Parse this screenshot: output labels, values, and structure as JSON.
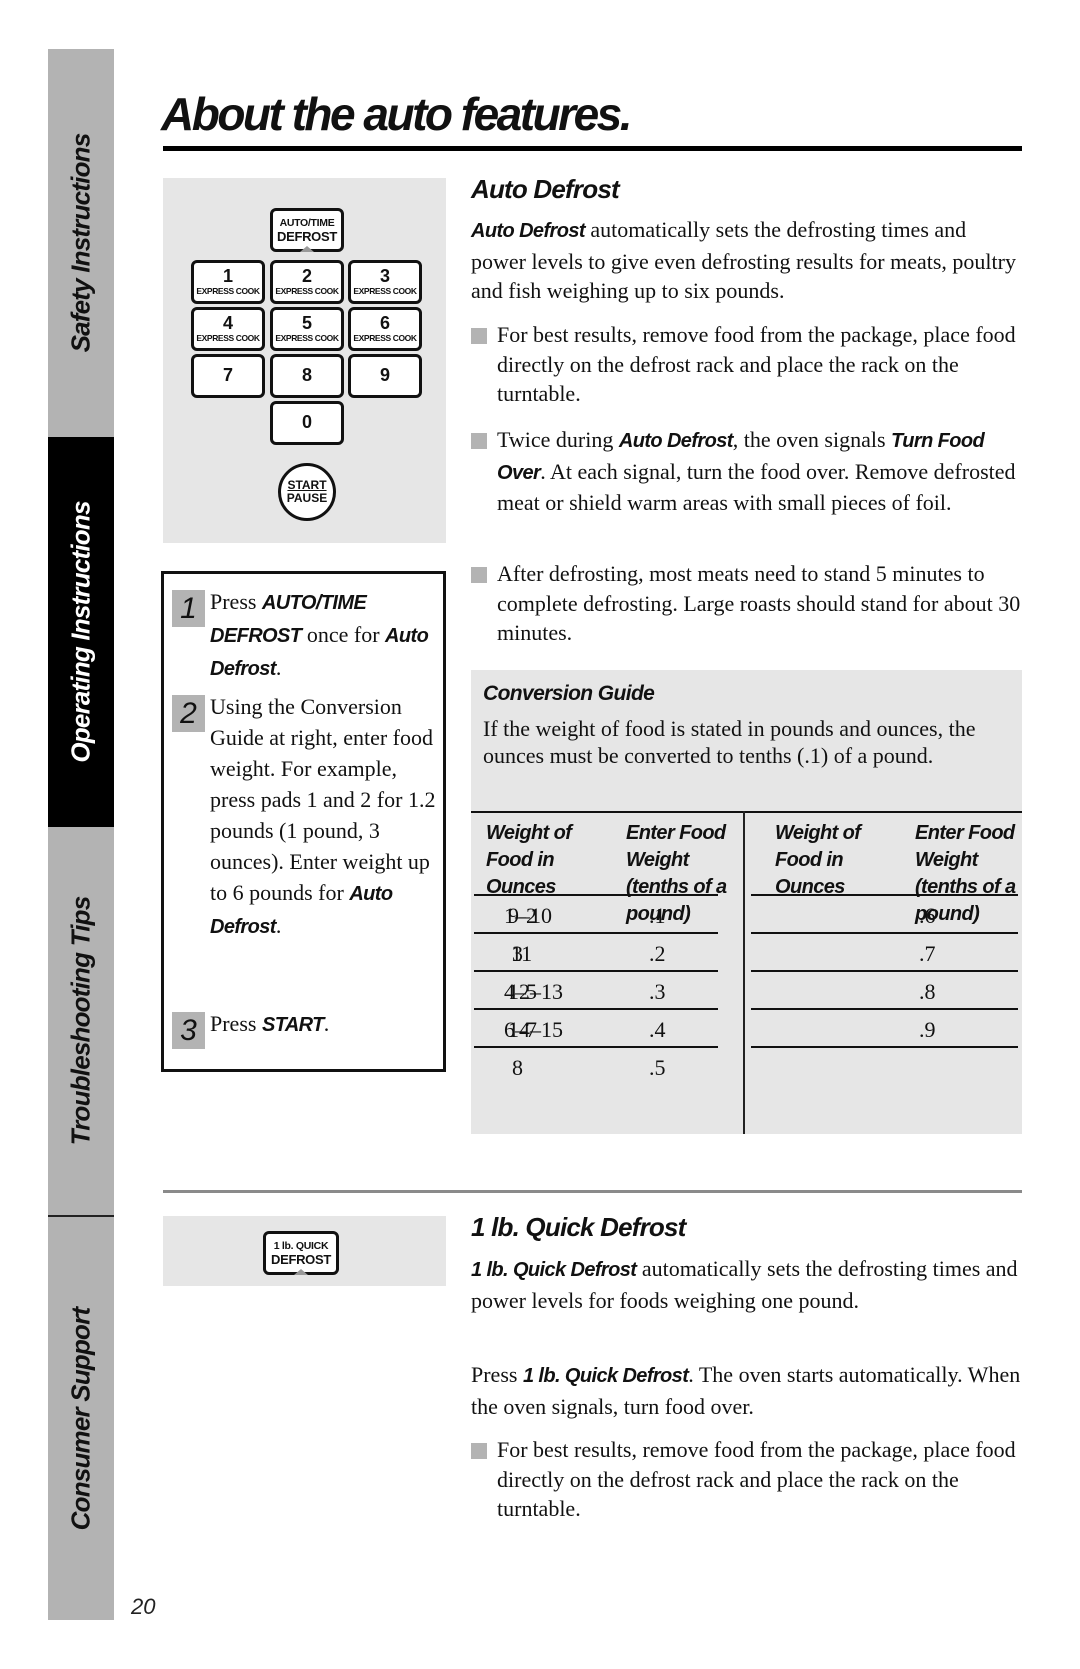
{
  "sidebar": {
    "tabs": [
      {
        "label": "Safety Instructions",
        "active": false
      },
      {
        "label": "Operating Instructions",
        "active": true
      },
      {
        "label": "Troubleshooting Tips",
        "active": false
      },
      {
        "label": "Consumer Support",
        "active": false
      }
    ]
  },
  "page": {
    "title": "About the auto features.",
    "number": "20"
  },
  "keypad": {
    "auto_time_defrost": [
      "AUTO/TIME",
      "DEFROST"
    ],
    "keys": [
      {
        "num": "1",
        "sub": "EXPRESS COOK"
      },
      {
        "num": "2",
        "sub": "EXPRESS COOK"
      },
      {
        "num": "3",
        "sub": "EXPRESS COOK"
      },
      {
        "num": "4",
        "sub": "EXPRESS COOK"
      },
      {
        "num": "5",
        "sub": "EXPRESS COOK"
      },
      {
        "num": "6",
        "sub": "EXPRESS COOK"
      },
      {
        "num": "7",
        "sub": ""
      },
      {
        "num": "8",
        "sub": ""
      },
      {
        "num": "9",
        "sub": ""
      },
      {
        "num": "0",
        "sub": ""
      }
    ],
    "start": "START",
    "pause": "PAUSE"
  },
  "steps": [
    {
      "num": "1",
      "parts": [
        {
          "t": "Press ",
          "b": false
        },
        {
          "t": "AUTO/TIME DEFROST",
          "b": true
        },
        {
          "t": " once for ",
          "b": false
        },
        {
          "t": "Auto Defrost",
          "b": true
        },
        {
          "t": ".",
          "b": false
        }
      ]
    },
    {
      "num": "2",
      "parts": [
        {
          "t": "Using the Conversion Guide at right, enter food weight. For example, press pads 1 and 2 for 1.2 pounds (1 pound, 3 ounces). Enter weight up to 6 pounds for ",
          "b": false
        },
        {
          "t": "Auto Defrost",
          "b": true
        },
        {
          "t": ".",
          "b": false
        }
      ]
    },
    {
      "num": "3",
      "parts": [
        {
          "t": "Press ",
          "b": false
        },
        {
          "t": "START",
          "b": true
        },
        {
          "t": ".",
          "b": false
        }
      ]
    }
  ],
  "auto_defrost": {
    "heading": "Auto Defrost",
    "intro_bold": "Auto Defrost",
    "intro_rest": " automatically sets the defrosting times and power levels to give even defrosting results for meats, poultry and fish weighing up to six pounds.",
    "bullets": [
      [
        {
          "t": "For best results, remove food from the package, place food directly on the defrost rack and place the rack on the turntable.",
          "b": false
        }
      ],
      [
        {
          "t": "Twice during ",
          "b": false
        },
        {
          "t": "Auto Defrost",
          "b": true
        },
        {
          "t": ", the oven signals ",
          "b": false
        },
        {
          "t": "Turn Food Over",
          "b": true
        },
        {
          "t": ". At each signal, turn the food over. Remove defrosted meat or shield warm areas with small pieces of foil.",
          "b": false
        }
      ],
      [
        {
          "t": "After defrosting, most meats need to stand 5 minutes to complete defrosting. Large roasts should stand for about 30 minutes.",
          "b": false
        }
      ]
    ]
  },
  "conversion_guide": {
    "heading": "Conversion Guide",
    "text": "If the weight of food is stated in pounds and ounces, the ounces must be converted to tenths (.1) of a pound.",
    "headers": [
      "Weight of Food in Ounces",
      "Enter Food Weight (tenths of a pound)"
    ],
    "left_rows": [
      [
        "1–2",
        ".1"
      ],
      [
        "3",
        ".2"
      ],
      [
        "4–5",
        ".3"
      ],
      [
        "6–7",
        ".4"
      ],
      [
        "8",
        ".5"
      ]
    ],
    "right_rows": [
      [
        "9–10",
        ".6"
      ],
      [
        "11",
        ".7"
      ],
      [
        "12–13",
        ".8"
      ],
      [
        "14–15",
        ".9"
      ]
    ]
  },
  "quick_defrost": {
    "button": [
      "1 lb. QUICK",
      "DEFROST"
    ],
    "heading": "1 lb. Quick Defrost",
    "intro_bold": "1 lb. Quick Defrost",
    "intro_rest": " automatically sets the defrosting times and power levels for foods weighing one pound.",
    "press_pre": "Press ",
    "press_bold": "1 lb. Quick Defrost",
    "press_rest": ". The oven starts automatically. When the oven signals, turn food over.",
    "bullet": "For best results, remove food from the package, place food directly on the defrost rack and place the rack on the turntable."
  }
}
